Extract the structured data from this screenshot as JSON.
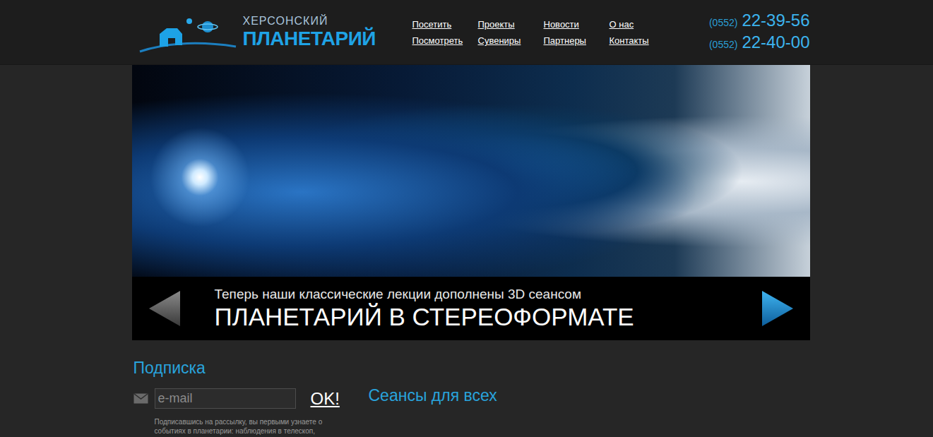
{
  "logo": {
    "line1": "ХЕРСОНСКИЙ",
    "line2": "ПЛАНЕТАРИЙ"
  },
  "nav": [
    {
      "links": [
        "Посетить",
        "Посмотреть"
      ]
    },
    {
      "links": [
        "Проекты",
        "Сувениры"
      ]
    },
    {
      "links": [
        "Новости",
        "Партнеры"
      ]
    },
    {
      "links": [
        "О нас",
        "Контакты"
      ]
    }
  ],
  "phones": [
    {
      "code": "(0552)",
      "number": "22-39-56"
    },
    {
      "code": "(0552)",
      "number": "22-40-00"
    }
  ],
  "slider": {
    "subtitle": "Теперь наши классические лекции дополнены 3D сеансом",
    "title": "ПЛАНЕТАРИЙ В СТЕРЕОФОРМАТЕ",
    "prev": {
      "disabled": true
    },
    "next": {
      "disabled": false
    }
  },
  "subscribe": {
    "title": "Подписка",
    "placeholder": "e-mail",
    "button": "OK!",
    "note": "Подписавшись на рассылку, вы первыми узнаете о событиях в планетарии: наблюдения в телескоп,"
  },
  "sessions": {
    "title": "Сеансы для всех"
  }
}
